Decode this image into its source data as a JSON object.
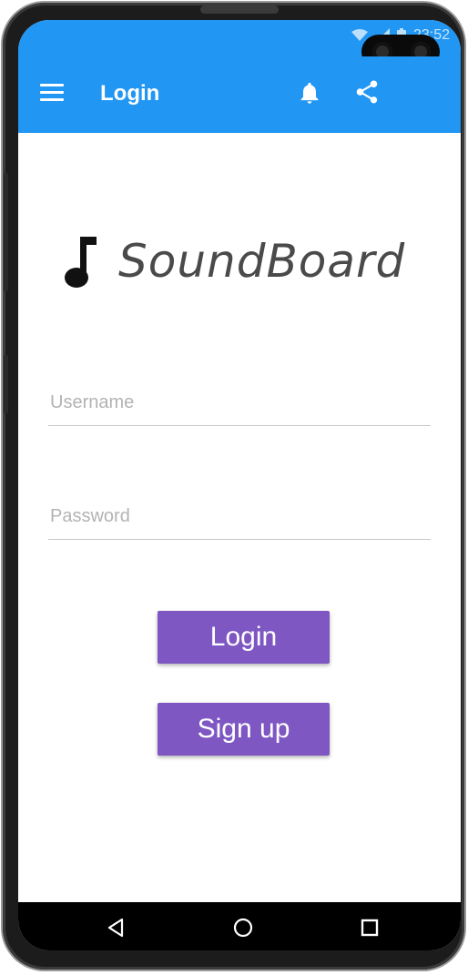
{
  "status_bar": {
    "time": "23:52",
    "icons": [
      "wifi-icon",
      "signal-icon",
      "battery-icon"
    ]
  },
  "app_bar": {
    "title": "Login",
    "icons": [
      "menu-icon",
      "bell-icon",
      "share-icon"
    ]
  },
  "logo": {
    "text": "SoundBoard",
    "icon": "music-note-icon"
  },
  "form": {
    "username_placeholder": "Username",
    "password_placeholder": "Password",
    "login_label": "Login",
    "signup_label": "Sign up"
  },
  "nav": {
    "icons": [
      "back-icon",
      "home-icon",
      "recents-icon"
    ]
  },
  "colors": {
    "app_bar": "#2196f3",
    "button": "#7e57c2",
    "logo_text": "#4a4a4a"
  }
}
